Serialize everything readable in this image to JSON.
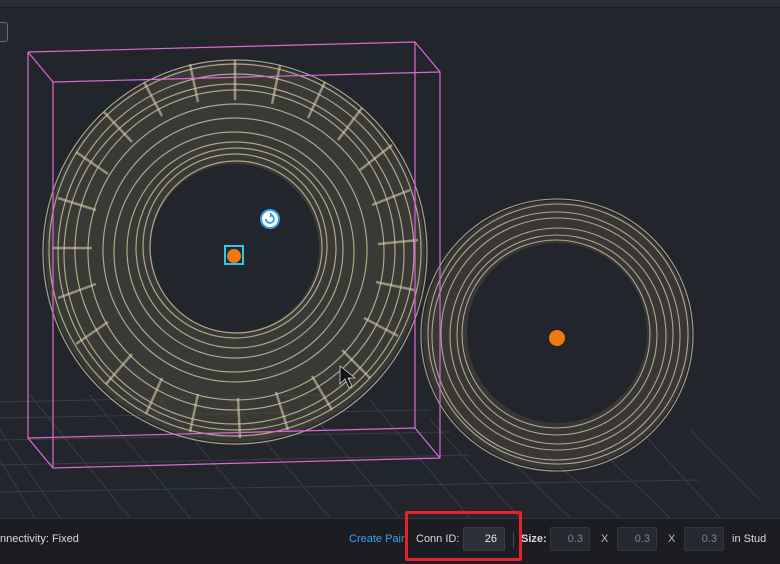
{
  "status": {
    "connectivity_text": "nnectivity: Fixed"
  },
  "toolbar": {
    "create_pair_label": "Create Pair",
    "conn_id_label": "Conn ID:",
    "conn_id_value": "26",
    "size_label": "Size:",
    "size_x": "0.3",
    "size_y": "0.3",
    "size_z": "0.3",
    "times_symbol_1": "X",
    "times_symbol_2": "X",
    "unit_label": "in Stud"
  },
  "colors": {
    "accent_link": "#3aa0e6",
    "highlight_box": "#e8202a",
    "selection_box": "#d86ad8",
    "pivot_marker": "#f07a10"
  }
}
